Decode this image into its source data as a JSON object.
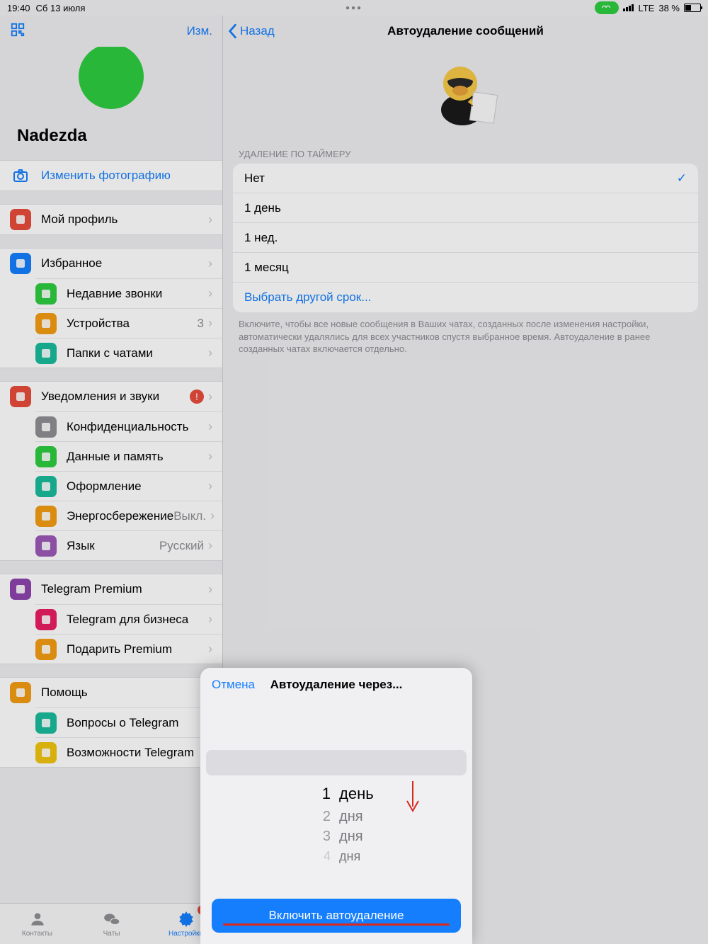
{
  "statusbar": {
    "time": "19:40",
    "date": "Сб 13 июля",
    "network": "LTE",
    "battery_pct": "38 %"
  },
  "sidebar": {
    "edit": "Изм.",
    "profile_name": "Nadezda",
    "change_photo": "Изменить фотографию",
    "groups": [
      {
        "items": [
          {
            "label": "Мой профиль",
            "icon": "person-icon",
            "color": "#e74c3c"
          }
        ]
      },
      {
        "items": [
          {
            "label": "Избранное",
            "icon": "bookmark-icon",
            "color": "#157efd"
          },
          {
            "label": "Недавние звонки",
            "icon": "phone-icon",
            "color": "#2ecc40"
          },
          {
            "label": "Устройства",
            "icon": "devices-icon",
            "color": "#f39c12",
            "value": "3"
          },
          {
            "label": "Папки с чатами",
            "icon": "folder-icon",
            "color": "#1abc9c"
          }
        ]
      },
      {
        "items": [
          {
            "label": "Уведомления и звуки",
            "icon": "bell-icon",
            "color": "#e74c3c",
            "badge": "!"
          },
          {
            "label": "Конфиденциальность",
            "icon": "lock-icon",
            "color": "#8e8e93"
          },
          {
            "label": "Данные и память",
            "icon": "data-icon",
            "color": "#2ecc40"
          },
          {
            "label": "Оформление",
            "icon": "palette-icon",
            "color": "#1abc9c"
          },
          {
            "label": "Энергосбережение",
            "icon": "battery-icon",
            "color": "#f39c12",
            "value": "Выкл."
          },
          {
            "label": "Язык",
            "icon": "globe-icon",
            "color": "#9b59b6",
            "value": "Русский"
          }
        ]
      },
      {
        "items": [
          {
            "label": "Telegram Premium",
            "icon": "star-icon",
            "color": "#8e44ad"
          },
          {
            "label": "Telegram для бизнеса",
            "icon": "briefcase-icon",
            "color": "#e91e63"
          },
          {
            "label": "Подарить Premium",
            "icon": "gift-icon",
            "color": "#f39c12"
          }
        ]
      },
      {
        "items": [
          {
            "label": "Помощь",
            "icon": "chat-icon",
            "color": "#f39c12"
          },
          {
            "label": "Вопросы о Telegram",
            "icon": "question-icon",
            "color": "#1abc9c"
          },
          {
            "label": "Возможности Telegram",
            "icon": "bulb-icon",
            "color": "#f1c40f"
          }
        ]
      }
    ]
  },
  "tabs": {
    "contacts": "Контакты",
    "chats": "Чаты",
    "settings": "Настройки",
    "settings_badge": "!"
  },
  "main": {
    "back": "Назад",
    "title": "Автоудаление сообщений",
    "section_header": "УДАЛЕНИЕ ПО ТАЙМЕРУ",
    "options": [
      {
        "label": "Нет",
        "selected": true
      },
      {
        "label": "1 день"
      },
      {
        "label": "1 нед."
      },
      {
        "label": "1 месяц"
      }
    ],
    "custom": "Выбрать другой срок...",
    "footer": "Включите, чтобы все новые сообщения в Ваших чатах, созданных после изменения настройки, автоматически удалялись для всех участников спустя выбранное время. Автоудаление в ранее созданных чатах включается отдельно."
  },
  "sheet": {
    "cancel": "Отмена",
    "title": "Автоудаление через...",
    "picker": [
      {
        "num": "1",
        "unit": "день",
        "level": "selected"
      },
      {
        "num": "2",
        "unit": "дня",
        "level": "faded"
      },
      {
        "num": "3",
        "unit": "дня",
        "level": "faded"
      },
      {
        "num": "4",
        "unit": "дня",
        "level": "faded2"
      }
    ],
    "cta": "Включить автоудаление"
  }
}
